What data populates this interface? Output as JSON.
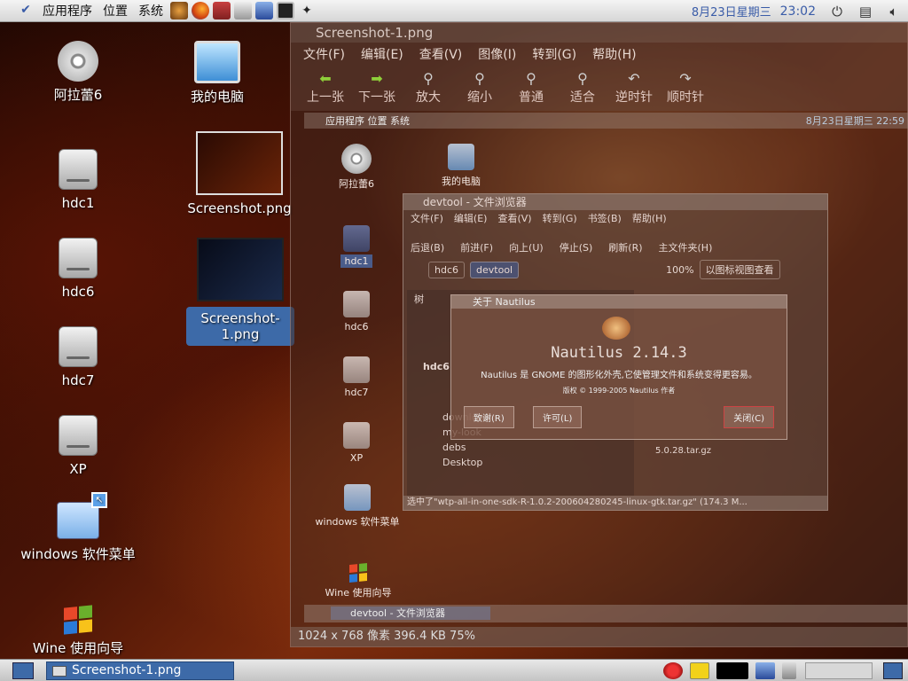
{
  "top_panel": {
    "menus": [
      "应用程序",
      "位置",
      "系统"
    ],
    "date": "8月23日星期三",
    "time": "23:02"
  },
  "desktop_icons": {
    "disc": "阿拉蕾6",
    "computer": "我的电脑",
    "hdc1": "hdc1",
    "hdc6": "hdc6",
    "hdc7": "hdc7",
    "xp": "XP",
    "windows_menu": "windows 软件菜单",
    "wine": "Wine 使用向导",
    "screenshot": "Screenshot.png",
    "screenshot1": "Screenshot-1.png"
  },
  "viewer": {
    "title": "Screenshot-1.png",
    "menus": [
      "文件(F)",
      "编辑(E)",
      "查看(V)",
      "图像(I)",
      "转到(G)",
      "帮助(H)"
    ],
    "toolbar": [
      "上一张",
      "下一张",
      "放大",
      "缩小",
      "普通",
      "适合",
      "逆时针",
      "顺时针"
    ],
    "status": "1024 x 768 像素   396.4 KB    75%"
  },
  "inner": {
    "panel_menus": "应用程序  位置  系统",
    "panel_date": "8月23日星期三 22:59",
    "icons": {
      "disc": "阿拉蕾6",
      "computer": "我的电脑",
      "hdc1": "hdc1",
      "hdc6": "hdc6",
      "hdc7": "hdc7",
      "xp": "XP",
      "windows_menu": "windows 软件菜单",
      "wine": "Wine 使用向导"
    },
    "file_browser": {
      "title": "devtool - 文件浏览器",
      "menus": [
        "文件(F)",
        "编辑(E)",
        "查看(V)",
        "转到(G)",
        "书签(B)",
        "帮助(H)"
      ],
      "tools": [
        "后退(B)",
        "前进(F)",
        "向上(U)",
        "停止(S)",
        "刷新(R)",
        "主文件夹(H)"
      ],
      "crumbs": [
        "hdc6",
        "devtool"
      ],
      "zoom": "100%",
      "view": "以图标视图查看",
      "tree_label": "树",
      "tree_items": [
        "hdc6",
        "download",
        "my-look",
        "debs",
        "Desktop"
      ],
      "file_name": "5.0.28.tar.gz",
      "status": "选中了\"wtp-all-in-one-sdk-R-1.0.2-200604280245-linux-gtk.tar.gz\" (174.3 M..."
    },
    "about": {
      "title": "关于 Nautilus",
      "name": "Nautilus 2.14.3",
      "desc": "Nautilus 是 GNOME 的图形化外壳,它使管理文件和系统变得更容易。",
      "copyright": "版权 © 1999-2005 Nautilus 作者",
      "credits": "致谢(R)",
      "license": "许可(L)",
      "close": "关闭(C)"
    },
    "taskbar_item": "devtool - 文件浏览器"
  },
  "bottom_panel": {
    "task": "Screenshot-1.png"
  },
  "colors": {
    "accent": "#3d6aa8",
    "panel_text_blue": "#3a5ca8",
    "toolbar_arrow": "#8fcf3a"
  }
}
